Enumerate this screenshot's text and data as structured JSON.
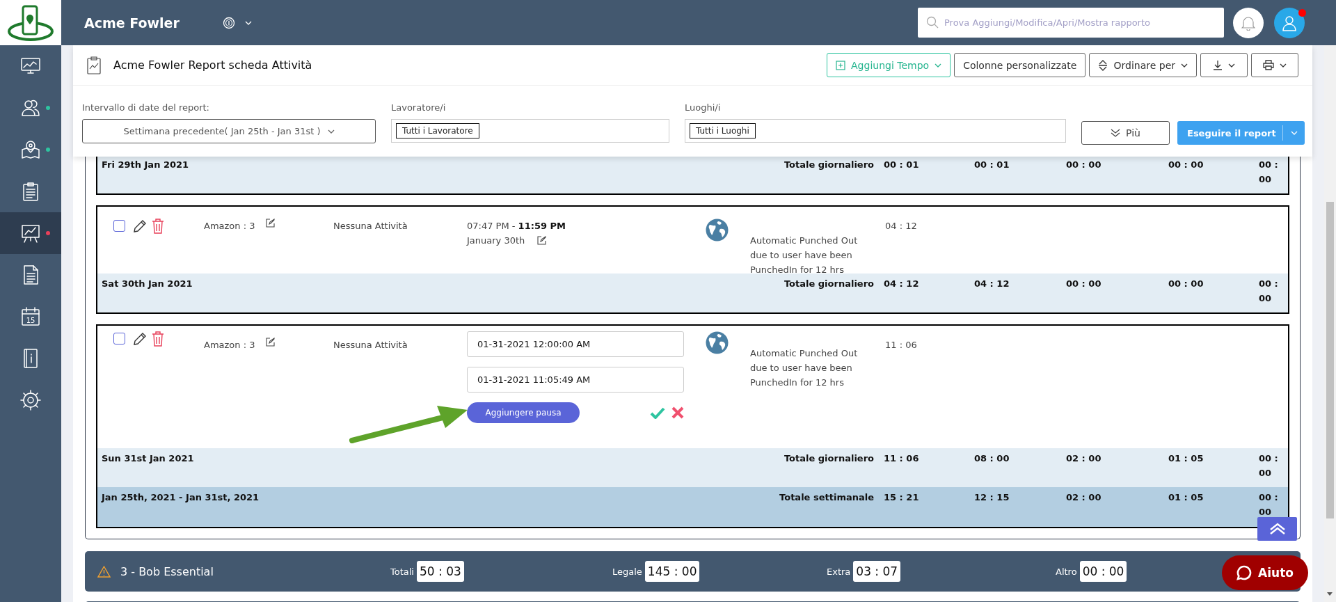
{
  "sidebar": {
    "items": [
      {
        "kind": "dashboard",
        "selected": false
      },
      {
        "kind": "people",
        "selected": false,
        "color": "#2ec4a0"
      },
      {
        "kind": "map",
        "selected": false,
        "color": "#2ec4a0"
      },
      {
        "kind": "tasks",
        "selected": false
      },
      {
        "kind": "reports",
        "selected": true,
        "color": "#e8405a"
      },
      {
        "kind": "document",
        "selected": false
      },
      {
        "kind": "calendar",
        "selected": false,
        "label": "15"
      },
      {
        "kind": "info",
        "selected": false
      },
      {
        "kind": "settings",
        "selected": false
      }
    ]
  },
  "topbar": {
    "company": "Acme Fowler",
    "search": {
      "placeholder": "Prova Aggiungi/Modifica/Apri/Mostra rapporto"
    },
    "has_notification": true
  },
  "report_header": {
    "title": "Acme Fowler Report scheda Attività",
    "actions": [
      {
        "kind": "add",
        "label": "Aggiungi Tempo"
      },
      {
        "kind": "plain",
        "label": "Colonne personalizzate"
      },
      {
        "kind": "sort",
        "label": "Ordinare per"
      },
      {
        "kind": "download"
      },
      {
        "kind": "print"
      }
    ],
    "filters": [
      {
        "kind": "dropdown",
        "label": "Intervallo di date del report:",
        "value": "Settimana precedente( Jan 25th - Jan 31st )"
      },
      {
        "kind": "tags",
        "label": "Lavoratore/i",
        "tags": [
          "Tutti i Lavoratore"
        ]
      },
      {
        "kind": "tags",
        "label": "Luoghi/i",
        "tags": [
          "Tutti i Luoghi"
        ]
      }
    ],
    "more_button": "Più",
    "run_button": "Eseguire il report"
  },
  "days": [
    {
      "date": "Fri 29th Jan 2021",
      "total_label": "Totale giornaliero",
      "totals": [
        "00 : 01",
        "00 : 01",
        "00 : 00",
        "00 : 00",
        "00 : 00"
      ]
    },
    {
      "date": "Sat 30th Jan 2021",
      "total_label": "Totale giornaliero",
      "totals": [
        "04 : 12",
        "04 : 12",
        "00 : 00",
        "00 : 00",
        "00 : 00"
      ],
      "entries": [
        {
          "kind": "view",
          "checked": false,
          "location": "Amazon : 3",
          "activity": "Nessuna Attività",
          "time": "07:47 PM - **11:59 PM**",
          "date": "January 30th",
          "note": "Automatic Punched Out due to user have been PunchedIn for 12 hrs",
          "duration": "04 : 12"
        }
      ]
    },
    {
      "date": "Sun 31st Jan 2021",
      "total_label": "Totale giornaliero",
      "totals": [
        "11 : 06",
        "08 : 00",
        "02 : 00",
        "01 : 05",
        "00 : 00"
      ],
      "entries": [
        {
          "kind": "edit",
          "checked": false,
          "location": "Amazon : 3",
          "activity": "Nessuna Attività",
          "start": "01-31-2021 12:00:00 AM",
          "end": "01-31-2021 11:05:49 AM",
          "break_button": "Aggiungere pausa",
          "note": "Automatic Punched Out due to user have been PunchedIn for 12 hrs",
          "duration": "11 : 06"
        }
      ]
    }
  ],
  "week_total": {
    "range": "Jan 25th, 2021  -  Jan 31st, 2021",
    "label": "Totale settimanale",
    "totals": [
      "15 : 21",
      "12 : 15",
      "02 : 00",
      "01 : 05",
      "00 : 00"
    ]
  },
  "employees": [
    {
      "name": "3 - Bob Essential",
      "warning": true,
      "stats": [
        {
          "label": "Totali",
          "value": "50 : 03"
        },
        {
          "label": "Legale",
          "value": "145 : 00"
        },
        {
          "label": "Extra",
          "value": "03 : 07"
        },
        {
          "label": "Altro",
          "value": "00 : 00"
        }
      ]
    }
  ],
  "annotation_arrow": true,
  "help_button": "Aiuto"
}
